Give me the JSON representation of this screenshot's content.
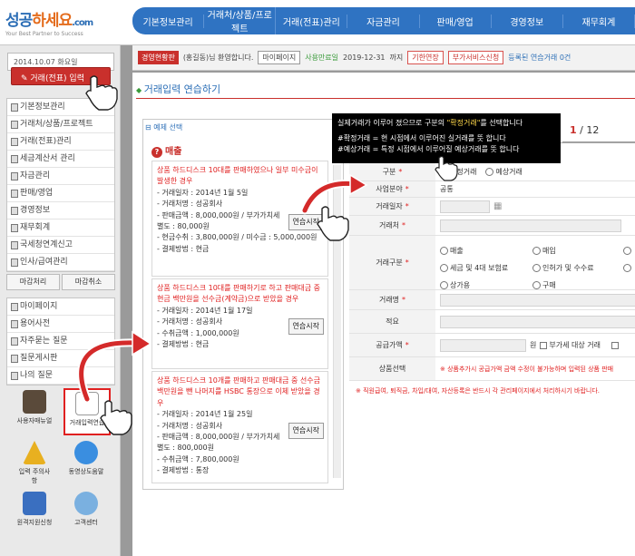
{
  "brand": {
    "name_a": "성공",
    "name_b": "하세요",
    "name_c": ".com",
    "slogan": "Your Best Partner to Success",
    "accent": "#2f73c2",
    "red": "#c9302c"
  },
  "nav": [
    "기본정보관리",
    "거래처/상품/프로젝트",
    "거래(전표)관리",
    "자금관리",
    "판매/영업",
    "경영정보",
    "재무회계"
  ],
  "sidebar": {
    "date": "2014.10.07 화요일",
    "entry_button": "거래(전표) 입력",
    "menu_a": [
      "기본정보관리",
      "거래처/상품/프로젝트",
      "거래(전표)관리",
      "세금계산서 관리",
      "자금관리",
      "판매/영업",
      "경영정보",
      "재무회계",
      "국세청연계신고",
      "인사/급여관리"
    ],
    "btn_close": "마감처리",
    "btn_cancel": "마감취소",
    "menu_b": [
      "마이페이지",
      "용어사전",
      "자주묻는 질문",
      "질문게시판",
      "나의 질문"
    ],
    "tiles": {
      "manual": "사용자매뉴얼",
      "practice": "거래입력연습",
      "caution": "입력 주의사항",
      "video": "동영상도움말",
      "remote": "원격지원신청",
      "center": "고객센터"
    }
  },
  "infobar": {
    "badge": "경영현황판",
    "greeting": "(홍길동)님 환영합니다.",
    "mypage": "마이페이지",
    "period_label": "사용만료일",
    "period_date": "2019-12-31",
    "period_suffix": "까지",
    "extend": "기한연장",
    "addon": "부가서비스신청",
    "practice_count": "등록된 연습거래 0건"
  },
  "page": {
    "title": "거래입력 연습하기",
    "example_title": "예제 선택",
    "section": "매출"
  },
  "examples": [
    {
      "headline": "상품 하드디스크 10대를 판매하였으나 일부 미수금이 발생한 경우",
      "lines": [
        "- 거래일자 : 2014년 1월 5일",
        "- 거래처명 : 성공회사",
        "- 판매금액 : 8,000,000원 / 부가가치세 별도 : 80,000원",
        "- 현금수취 : 3,800,000원 / 미수금 : 5,000,000원",
        "- 결제방법 : 현금"
      ],
      "button": "연습시작"
    },
    {
      "headline": "상품 하드디스크 10대를 판매하기로 하고 판매대금 중 현금 백만원을 선수금(계약금)으로 받았을 경우",
      "lines": [
        "- 거래일자 : 2014년 1월 17일",
        "- 거래처명 : 성공회사",
        "- 수취금액 : 1,000,000원",
        "- 결제방법 : 현금"
      ],
      "button": "연습시작"
    },
    {
      "headline": "상품 하드디스크 10개를 판매하고 판매대금 중 선수금 백만원을 뺀 나머지를 HSBC 통장으로 이체 받았을 경우",
      "lines": [
        "- 거래일자 : 2014년 1월 25일",
        "- 거래처명 : 성공회사",
        "- 판매금액 : 8,000,000원 / 부가가치세 별도 : 800,000원",
        "- 수취금액 : 7,800,000원",
        "- 결제방법 : 통장"
      ],
      "button": "연습시작"
    }
  ],
  "tooltip": {
    "pre": "실제거래가 이루어 졌으므로 구분의 ",
    "hl": "\"확정거래\"",
    "post": "를 선택합니다",
    "line1": "#확정거래 = 현 시점에서 이루어진 실거래를 뜻 합니다",
    "line2": "#예상거래 = 특정 시점에서 이루어질 예상거래를 뜻 합니다"
  },
  "pager": {
    "current": "1",
    "sep": " / ",
    "total": "12"
  },
  "form": {
    "gubun": {
      "label": "구분",
      "opt1": "확정거래",
      "opt2": "예상거래"
    },
    "business": {
      "label": "사업분야",
      "value": "공통"
    },
    "date": {
      "label": "거래일자"
    },
    "partner": {
      "label": "거래처"
    },
    "type": {
      "label": "거래구분",
      "opts": [
        "매출",
        "매입",
        "세금 및 4대 보험료",
        "인허가 및 수수료",
        "상가용",
        "구매"
      ]
    },
    "name": {
      "label": "거래명"
    },
    "memo": {
      "label": "적요"
    },
    "amount": {
      "label": "공급가액",
      "unit": "원",
      "vat_none": "부가세 대상 거래"
    },
    "product": {
      "label": "상품선택",
      "note": "※ 상품추가시 공급가액 금액 수정이 불가능하며 입력된 상품 판매"
    },
    "footnote": "※ 직원급여, 퇴직금, 차입/대여, 자산등록은 반드시 각 관리페이지에서 처리하시기 바랍니다."
  }
}
